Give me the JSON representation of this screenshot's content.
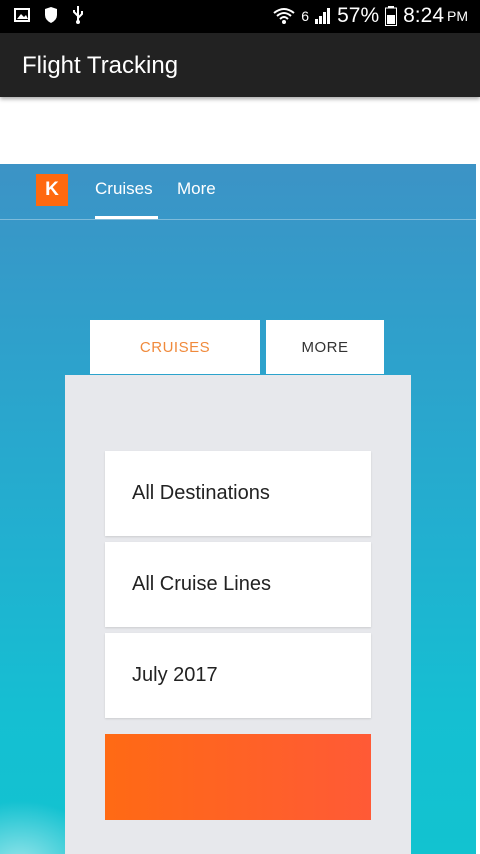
{
  "status_bar": {
    "signal_label": "6",
    "battery": "57%",
    "time": "8:24",
    "ampm": "PM",
    "icons": [
      "gallery-icon",
      "shield-icon",
      "usb-icon",
      "wifi-icon",
      "signal-icon",
      "battery-icon"
    ]
  },
  "app_bar": {
    "title": "Flight Tracking"
  },
  "site_nav": {
    "logo_letter": "K",
    "tabs": [
      "Cruises",
      "More"
    ]
  },
  "search_tabs": {
    "cruises": "CRUISES",
    "more": "MORE"
  },
  "form": {
    "destination": "All Destinations",
    "cruise_lines": "All Cruise Lines",
    "date": "July 2017"
  },
  "colors": {
    "accent": "#ff690f",
    "tab_active": "#f08a3c",
    "app_bar": "#222222"
  }
}
